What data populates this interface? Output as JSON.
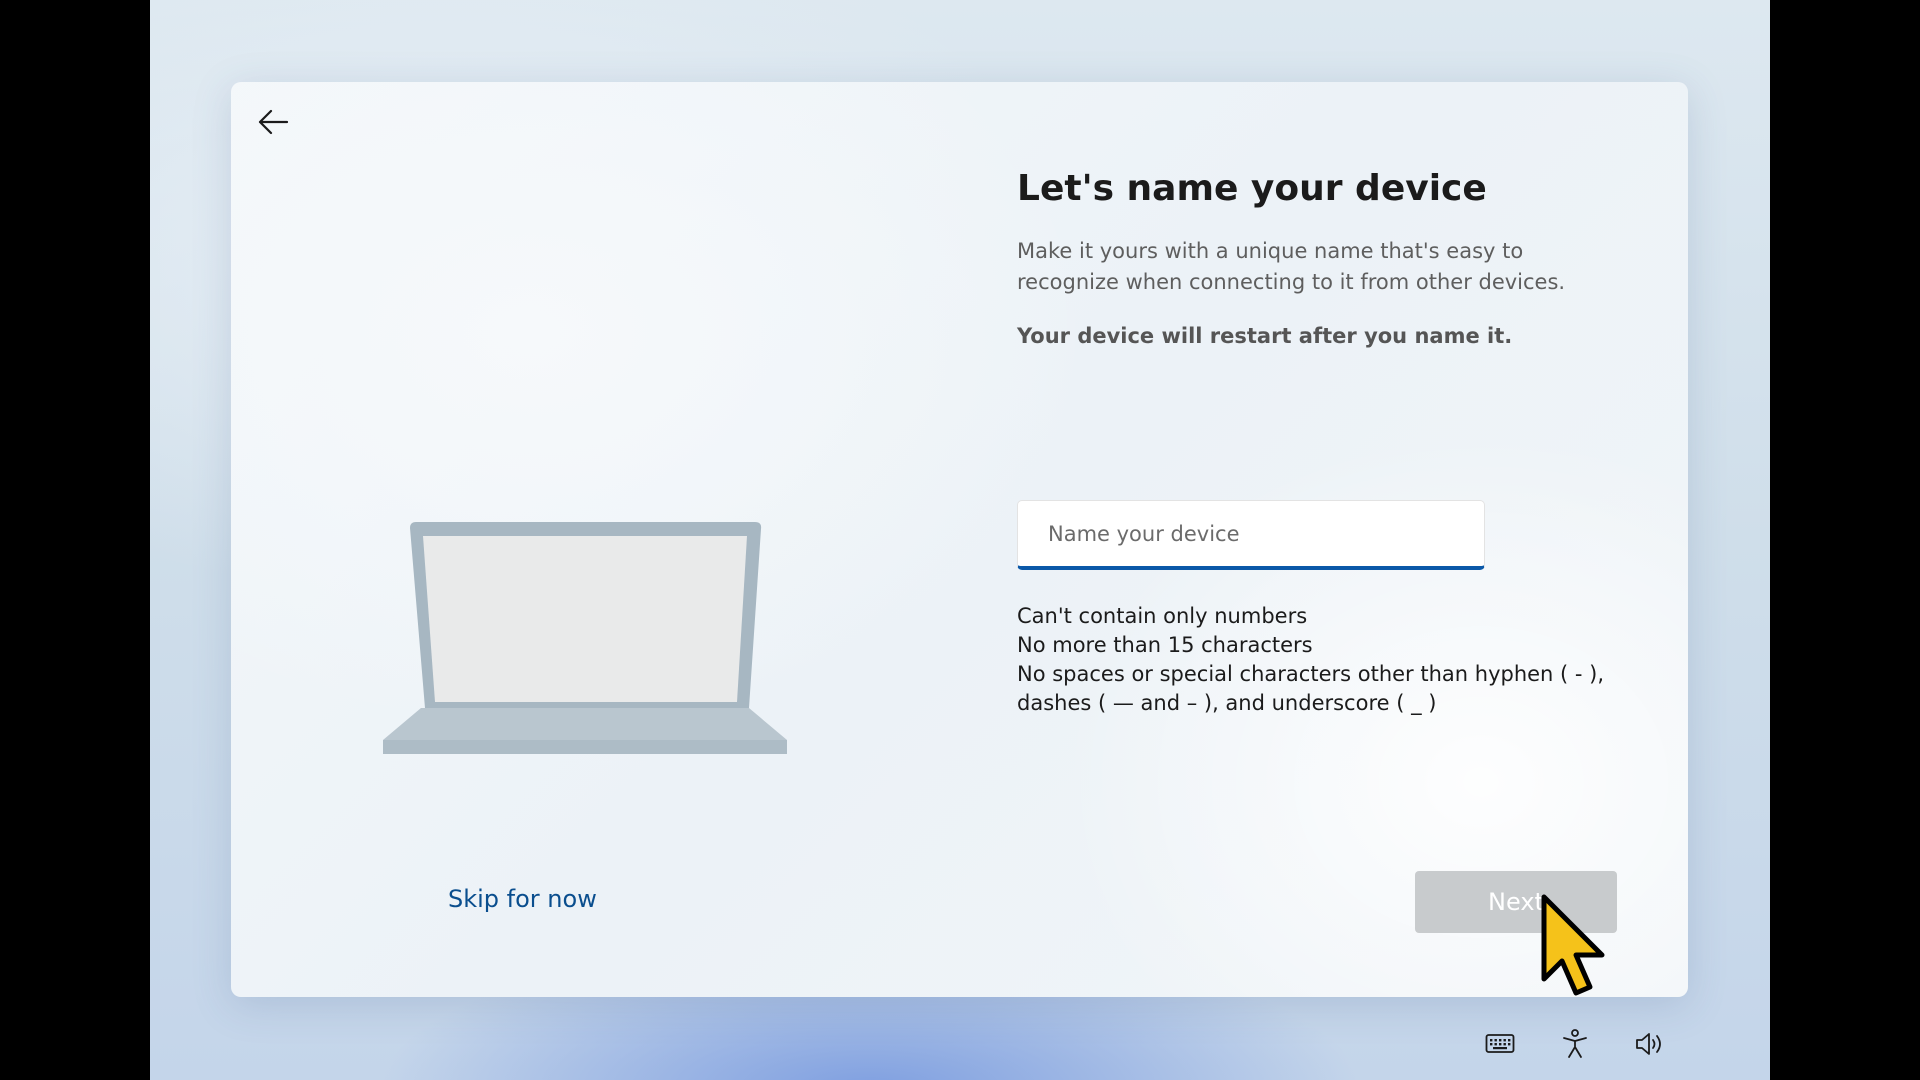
{
  "page": {
    "title": "Let's name your device",
    "description": "Make it yours with a unique name that's easy to recognize when connecting to it from other devices.",
    "warning": "Your device will restart after you name it."
  },
  "name_input": {
    "placeholder": "Name your device",
    "value": ""
  },
  "rules": [
    "Can't contain only numbers",
    "No more than 15 characters",
    "No spaces or special characters other than hyphen ( - ), dashes ( — and – ), and underscore ( _ )"
  ],
  "actions": {
    "skip_label": "Skip for now",
    "next_label": "Next"
  },
  "icons": {
    "back": "back-arrow-icon",
    "keyboard": "keyboard-icon",
    "accessibility": "accessibility-icon",
    "volume": "volume-icon",
    "illustration": "laptop-illustration"
  },
  "colors": {
    "accent": "#0a58a8",
    "link": "#0a4e8e",
    "disabled_button": "#c8cbcd"
  }
}
